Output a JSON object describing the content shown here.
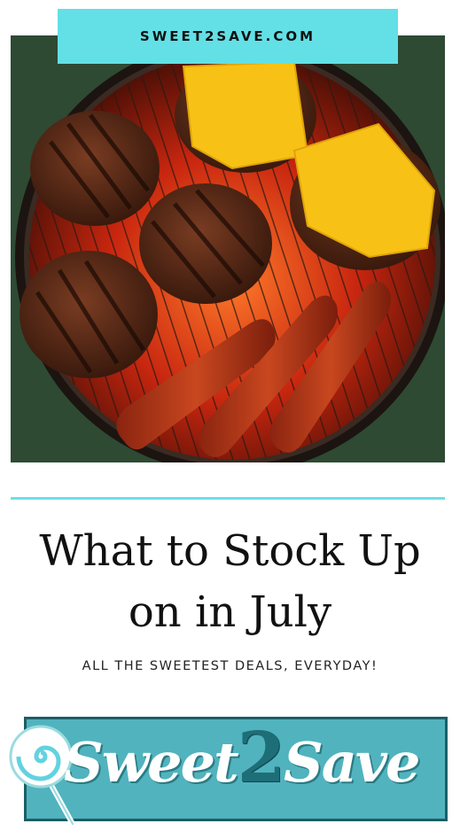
{
  "header": {
    "site_name": "SWEET2SAVE.COM"
  },
  "hero_image": {
    "alt": "Grill with cheeseburgers and hot dogs"
  },
  "article": {
    "title_line1": "What to Stock Up",
    "title_line2": "on in July",
    "tagline": "ALL THE SWEETEST DEALS, EVERYDAY!"
  },
  "logo": {
    "text_before": "Sweet",
    "text_number": "2",
    "text_after": "Save",
    "icon": "lollipop-icon"
  },
  "colors": {
    "accent": "#62e0e6",
    "logo_bg": "#51b3be",
    "logo_dark": "#1e6e78"
  }
}
